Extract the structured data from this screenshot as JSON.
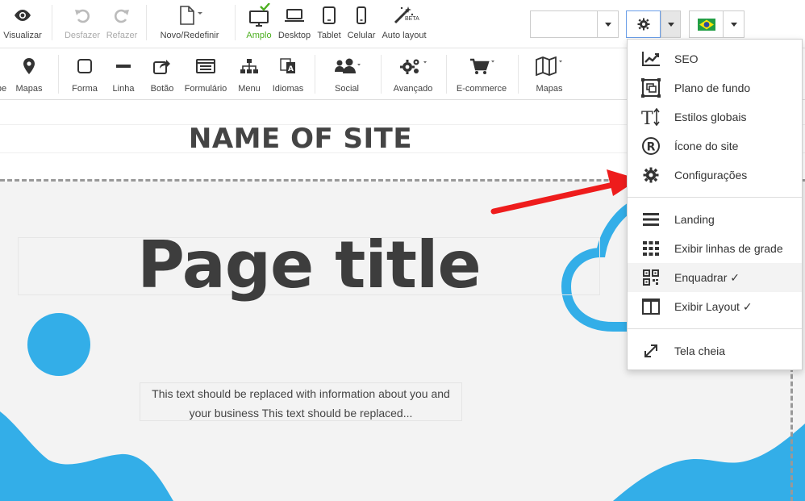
{
  "toolbar": {
    "view_label": "Visualizar",
    "undo_label": "Desfazer",
    "redo_label": "Refazer",
    "new_label": "Novo/Redefinir",
    "wide_label": "Amplo",
    "desktop_label": "Desktop",
    "tablet_label": "Tablet",
    "mobile_label": "Celular",
    "autolayout_label": "Auto layout",
    "beta_badge": "BETA",
    "page_select_value": "",
    "active_device": "Amplo",
    "active_color": "#4caf1f"
  },
  "toolbar2": {
    "items": [
      {
        "label": "pe"
      },
      {
        "label": "Mapas"
      },
      {
        "label": "Forma"
      },
      {
        "label": "Linha"
      },
      {
        "label": "Botão"
      },
      {
        "label": "Formulário"
      },
      {
        "label": "Menu"
      },
      {
        "label": "Idiomas"
      },
      {
        "label": "Social"
      },
      {
        "label": "Avançado"
      },
      {
        "label": "E-commerce"
      },
      {
        "label": "Mapas"
      }
    ]
  },
  "canvas": {
    "site_name": "NAME OF SITE",
    "page_title": "Page title",
    "body_text": "This text should be replaced with information about you and your business This text should be replaced...",
    "accent_color": "#33aee8",
    "section_bg": "#f3f3f3"
  },
  "menu": {
    "items": [
      {
        "label": "SEO",
        "icon": "chart-line-icon"
      },
      {
        "label": "Plano de fundo",
        "icon": "background-image-icon"
      },
      {
        "label": "Estilos globais",
        "icon": "text-height-icon"
      },
      {
        "label": "Ícone do site",
        "icon": "registered-icon"
      },
      {
        "label": "Configurações",
        "icon": "gear-icon"
      },
      {
        "label": "Landing",
        "icon": "menu-bars-icon"
      },
      {
        "label": "Exibir linhas de grade",
        "icon": "grid-icon"
      },
      {
        "label": "Enquadrar ✓",
        "icon": "qr-code-icon"
      },
      {
        "label": "Exibir Layout ✓",
        "icon": "columns-icon"
      },
      {
        "label": "Tela cheia",
        "icon": "expand-icon"
      }
    ]
  },
  "annotation_color": "#ee1c1c"
}
